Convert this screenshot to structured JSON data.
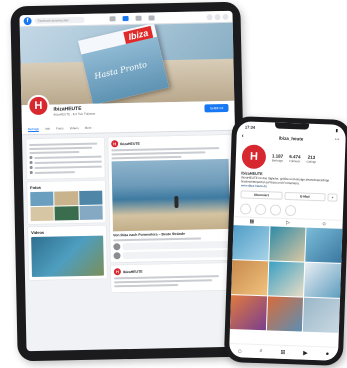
{
  "tablet": {
    "facebook": {
      "search_placeholder": "Facebook durchsuchen",
      "cover": {
        "magazine_title": "Ibiza",
        "magazine_script": "Hasta Pronto"
      },
      "page": {
        "name": "IbizaHEUTE",
        "subtitle": "IbizaHEUTE · 8,3 Tsd. Follower",
        "follow_button": "Gefällt mir",
        "tabs": [
          "Beiträge",
          "Info",
          "Fotos",
          "Videos",
          "Mehr"
        ]
      },
      "sidebar": {
        "photos_title": "Fotos",
        "videos_title": "Videos"
      },
      "post": {
        "author": "IbizaHEUTE",
        "caption": "Von Ibiza nach Formentera – Beste Strände"
      },
      "comment_author": "Michael Gruner"
    },
    "colors": {
      "fb_blue": "#1877f2",
      "brand_red": "#d7272f"
    }
  },
  "phone": {
    "status_time": "17:34",
    "profile_handle": "ibiza_heute",
    "avatar_letter": "H",
    "stats": [
      {
        "num": "1.187",
        "label": "Beiträge"
      },
      {
        "num": "6.474",
        "label": "Follower"
      },
      {
        "num": "213",
        "label": "Gefolgt"
      }
    ],
    "bio": {
      "name": "IbizaHEUTE",
      "text": "IbizaHEUTE ist das tägliche, größte und einzige deutschsprachige Nachrichtenportal auf Ibiza und Formentera.",
      "link": "www.ibiza-heute.de"
    },
    "buttons": [
      "Abonniert",
      "E-Mail"
    ],
    "nav_icons": [
      "home-icon",
      "search-icon",
      "add-icon",
      "reels-icon",
      "profile-icon"
    ]
  }
}
